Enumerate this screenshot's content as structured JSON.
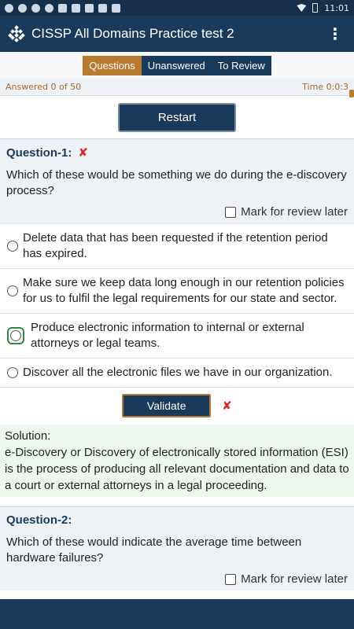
{
  "status_bar": {
    "time": "11:01"
  },
  "app_bar": {
    "title": "CISSP All Domains Practice test 2",
    "menu_icon": "⋮"
  },
  "tabs": [
    {
      "label": "Questions"
    },
    {
      "label": "Unanswered"
    },
    {
      "label": "To Review"
    }
  ],
  "progress": {
    "answered": "Answered 0 of 50",
    "time": "Time 0:0:3"
  },
  "restart_label": "Restart",
  "question1": {
    "label": "Question-1:",
    "text": "Which of these would be something we do during the e-discovery process?",
    "review_label": "Mark for review later",
    "options": [
      "Delete data that has been requested if the retention period has expired.",
      "Make sure we keep data long enough in our retention policies for us to fulfil the legal requirements for our state and sector.",
      "Produce electronic information to internal or external attorneys or legal teams.",
      "Discover all the electronic files we have in our organization."
    ],
    "validate_label": "Validate",
    "solution_heading": "Solution:",
    "solution_text": "e-Discovery or Discovery of electronically stored information (ESI) is the process of producing all relevant documentation and data to a court or external attorneys in a legal proceeding."
  },
  "question2": {
    "label": "Question-2:",
    "text": "Which of these would indicate the average time between hardware failures?",
    "review_label": "Mark for review later"
  },
  "wrong_mark": "✘",
  "colors": {
    "app_bar": "#1a3a5c",
    "accent": "#b87a2e",
    "wrong": "#e02020",
    "selected_option": "#2e8b3e"
  }
}
